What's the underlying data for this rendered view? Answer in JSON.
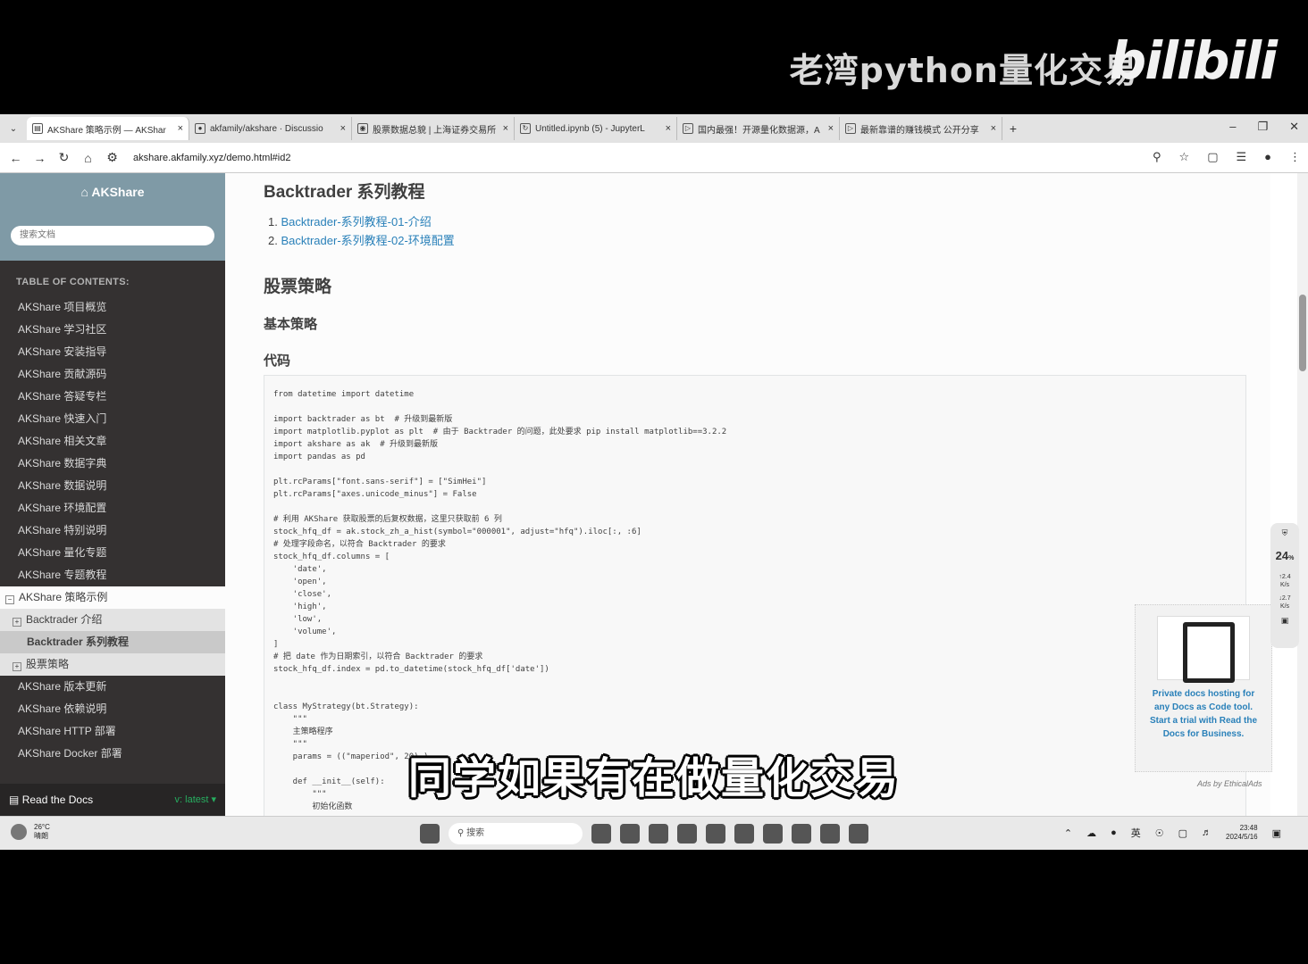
{
  "video": {
    "channel_title": "老湾python量化交易",
    "logo": "bilibili",
    "subtitle": "同学如果有在做量化交易"
  },
  "browser": {
    "tabs": [
      {
        "title": "AKShare 策略示例 — AKShar",
        "icon": "doc-icon"
      },
      {
        "title": "akfamily/akshare · Discussio",
        "icon": "github-icon"
      },
      {
        "title": "股票数据总貌 | 上海证券交易所",
        "icon": "sse-icon"
      },
      {
        "title": "Untitled.ipynb (5) - JupyterL",
        "icon": "jupyter-icon"
      },
      {
        "title": "国内最强！开源量化数据源，A",
        "icon": "bilibili-icon"
      },
      {
        "title": "最新靠谱的赚钱模式 公开分享",
        "icon": "bilibili-icon"
      }
    ],
    "url": "akshare.akfamily.xyz/demo.html#id2"
  },
  "sidebar": {
    "brand": "AKShare",
    "search_placeholder": "搜索文档",
    "toc_caption": "TABLE OF CONTENTS:",
    "items": [
      "AKShare 项目概览",
      "AKShare 学习社区",
      "AKShare 安装指导",
      "AKShare 贡献源码",
      "AKShare 答疑专栏",
      "AKShare 快速入门",
      "AKShare 相关文章",
      "AKShare 数据字典",
      "AKShare 数据说明",
      "AKShare 环境配置",
      "AKShare 特别说明",
      "AKShare 量化专题",
      "AKShare 专题教程"
    ],
    "current": "AKShare 策略示例",
    "sub_items": [
      {
        "label": "Backtrader 介绍"
      },
      {
        "label": "Backtrader 系列教程"
      },
      {
        "label": "股票策略"
      }
    ],
    "items_after": [
      "AKShare 版本更新",
      "AKShare 依赖说明",
      "AKShare HTTP 部署",
      "AKShare Docker 部署"
    ],
    "footer": "Read the Docs",
    "version": "v: latest"
  },
  "main": {
    "h_backtrader": "Backtrader 系列教程",
    "list": [
      "Backtrader-系列教程-01-介绍",
      "Backtrader-系列教程-02-环境配置"
    ],
    "h_stock": "股票策略",
    "h_basic": "基本策略",
    "h_code": "代码",
    "code": "from datetime import datetime\n\nimport backtrader as bt  # 升级到最新版\nimport matplotlib.pyplot as plt  # 由于 Backtrader 的问题，此处要求 pip install matplotlib==3.2.2\nimport akshare as ak  # 升级到最新版\nimport pandas as pd\n\nplt.rcParams[\"font.sans-serif\"] = [\"SimHei\"]\nplt.rcParams[\"axes.unicode_minus\"] = False\n\n# 利用 AKShare 获取股票的后复权数据，这里只获取前 6 列\nstock_hfq_df = ak.stock_zh_a_hist(symbol=\"000001\", adjust=\"hfq\").iloc[:, :6]\n# 处理字段命名，以符合 Backtrader 的要求\nstock_hfq_df.columns = [\n    'date',\n    'open',\n    'close',\n    'high',\n    'low',\n    'volume',\n]\n# 把 date 作为日期索引，以符合 Backtrader 的要求\nstock_hfq_df.index = pd.to_datetime(stock_hfq_df['date'])\n\n\nclass MyStrategy(bt.Strategy):\n    \"\"\"\n    主策略程序\n    \"\"\"\n    params = ((\"maperiod\", 20),)\n\n    def __init__(self):\n        \"\"\"\n        初始化函数"
  },
  "ad": {
    "text": "Private docs hosting for any Docs as Code tool. Start a trial with Read the Docs for Business.",
    "by": "Ads by EthicalAds"
  },
  "float_widget": {
    "value": "24",
    "unit": "%",
    "up": "2.4",
    "down": "2.7",
    "rate_unit": "K/s"
  },
  "taskbar": {
    "temp": "26°C",
    "weather": "晴朗",
    "search": "搜索",
    "ime": "英",
    "time": "23:48",
    "date": "2024/5/16"
  }
}
